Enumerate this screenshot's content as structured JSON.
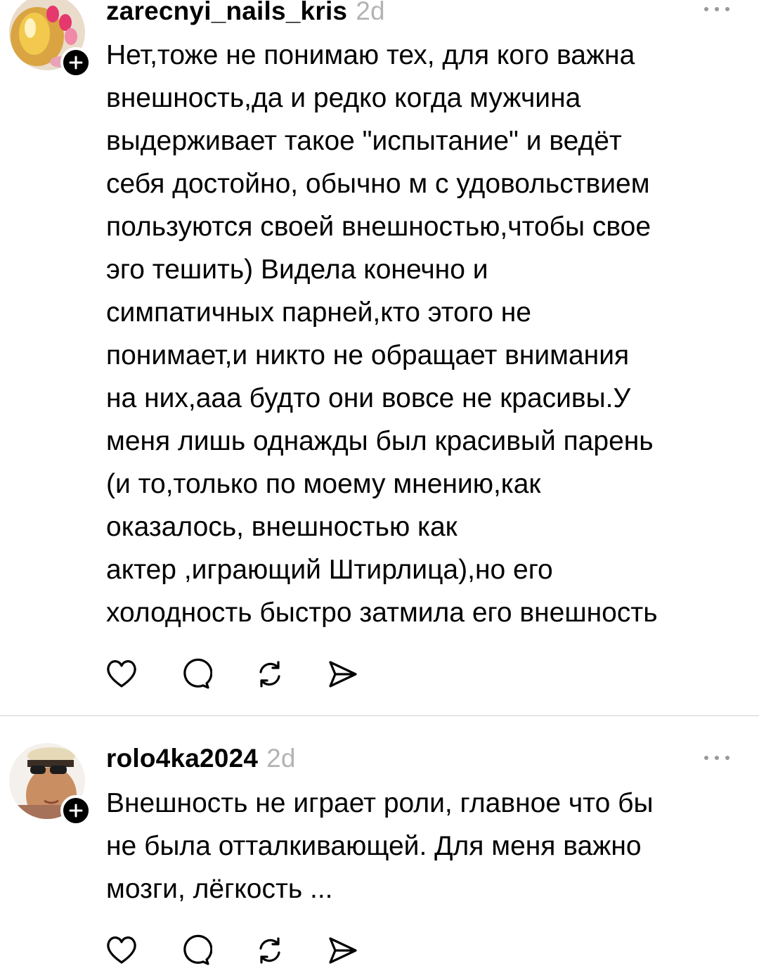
{
  "posts": [
    {
      "username": "zarecnyi_nails_kris",
      "time": "2d",
      "avatar_icon": "nail-art-photo",
      "text": "Нет,тоже не понимаю тех, для кого важна\nвнешность,да и редко когда мужчина\nвыдерживает такое \"испытание\" и ведёт\nсебя достойно, обычно м с удовольствием\nпользуются своей внешностью,чтобы свое\nэго тешить) Видела конечно и\nсимпатичных парней,кто этого не\nпонимает,и никто не обращает внимания\nна них,ааа будто они вовсе не красивы.У\nменя лишь однажды был красивый парень\n(и то,только по моему мнению,как\nоказалось, внешностью как\nактер ,играющий Штирлица),но его\nхолодность быстро затмила его внешность"
    },
    {
      "username": "rolo4ka2024",
      "time": "2d",
      "avatar_icon": "person-selfie-photo",
      "text": "Внешность не играет роли, главное что бы\nне была отталкивающей.  Для меня важно\nмозги, лёгкость ..."
    }
  ],
  "icons": {
    "like": "heart-icon",
    "reply": "comment-icon",
    "repost": "repost-icon",
    "share": "send-icon",
    "more": "more-icon",
    "follow": "plus-icon"
  },
  "colors": {
    "text": "#000000",
    "muted": "#b3b3b3",
    "divider": "#e6e6e6"
  }
}
